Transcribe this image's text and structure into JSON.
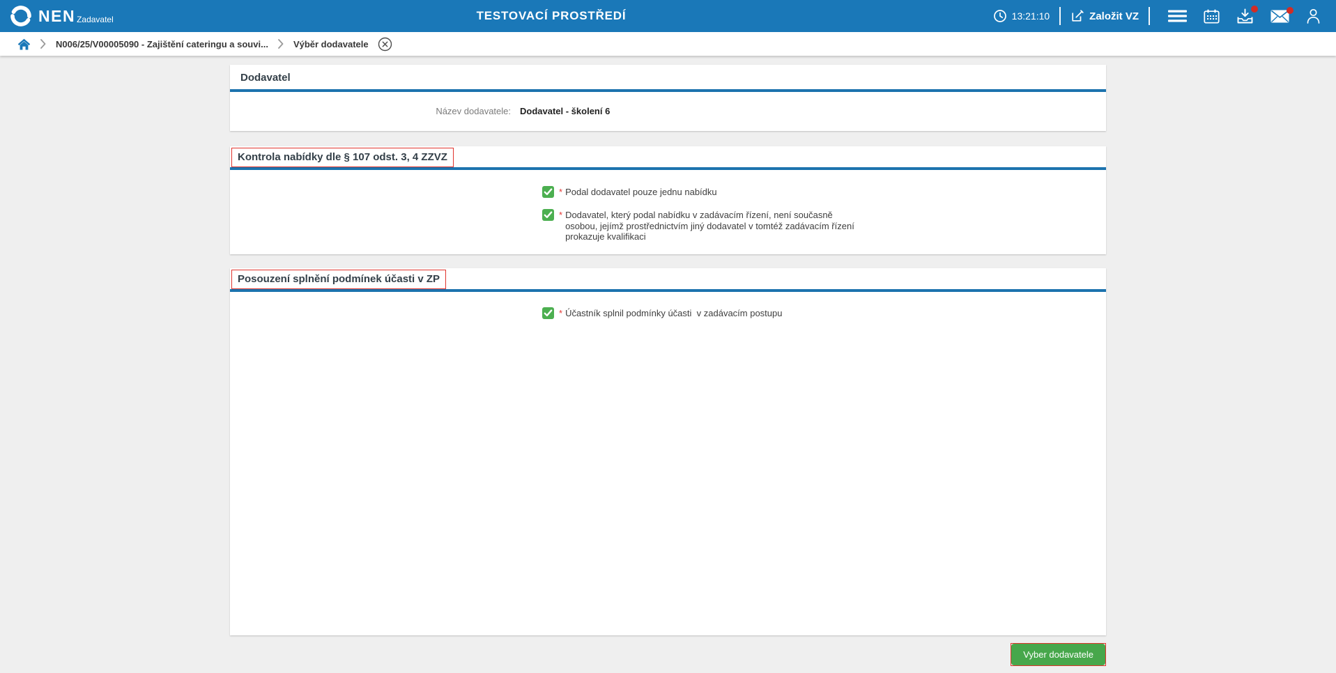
{
  "colors": {
    "header_blue": "#1A78B8",
    "section_line_blue": "#1C73AE",
    "checkbox_green": "#4CAF50",
    "button_green": "#47A74B",
    "highlight_red": "#E0332C",
    "required_red": "#E53935",
    "badge_red": "#D22C25",
    "background_gray": "#EFEFEF"
  },
  "header": {
    "logo_title": "NEN",
    "logo_subtitle": "Zadavatel",
    "env_title": "TESTOVACÍ PROSTŘEDÍ",
    "time": "13:21:10",
    "create_vz_label": "Založit VZ",
    "icons": [
      "clock-icon",
      "edit-icon",
      "menu-icon",
      "calendar-icon",
      "inbox-download-icon",
      "mail-icon",
      "user-icon"
    ],
    "inbox_has_notification": true,
    "mail_has_notification": true
  },
  "breadcrumb": {
    "items": [
      "N006/25/V00005090 - Zajištění cateringu a souvi...",
      "Výběr dodavatele"
    ]
  },
  "supplier_section": {
    "title": "Dodavatel",
    "field_label": "Název dodavatele:",
    "field_value": "Dodavatel - školení 6"
  },
  "control_section": {
    "title": "Kontrola nabídky dle § 107 odst. 3, 4 ZZVZ",
    "checkboxes": [
      {
        "mark": "*",
        "label": "Podal dodavatel pouze jednu nabídku",
        "checked": true
      },
      {
        "mark": "*",
        "label": "Dodavatel, který podal nabídku v zadávacím řízení, není současně\nosobou, jejímž prostřednictvím jiný dodavatel v tomtéž zadávacím řízení\nprokazuje kvalifikaci",
        "checked": true
      }
    ]
  },
  "assessment_section": {
    "title": "Posouzení splnění podmínek účasti v ZP",
    "checkboxes": [
      {
        "mark": "*",
        "label": "Účastník splnil podmínky účasti  v zadávacím postupu",
        "checked": true
      }
    ]
  },
  "footer": {
    "select_button": "Vyber dodavatele"
  }
}
